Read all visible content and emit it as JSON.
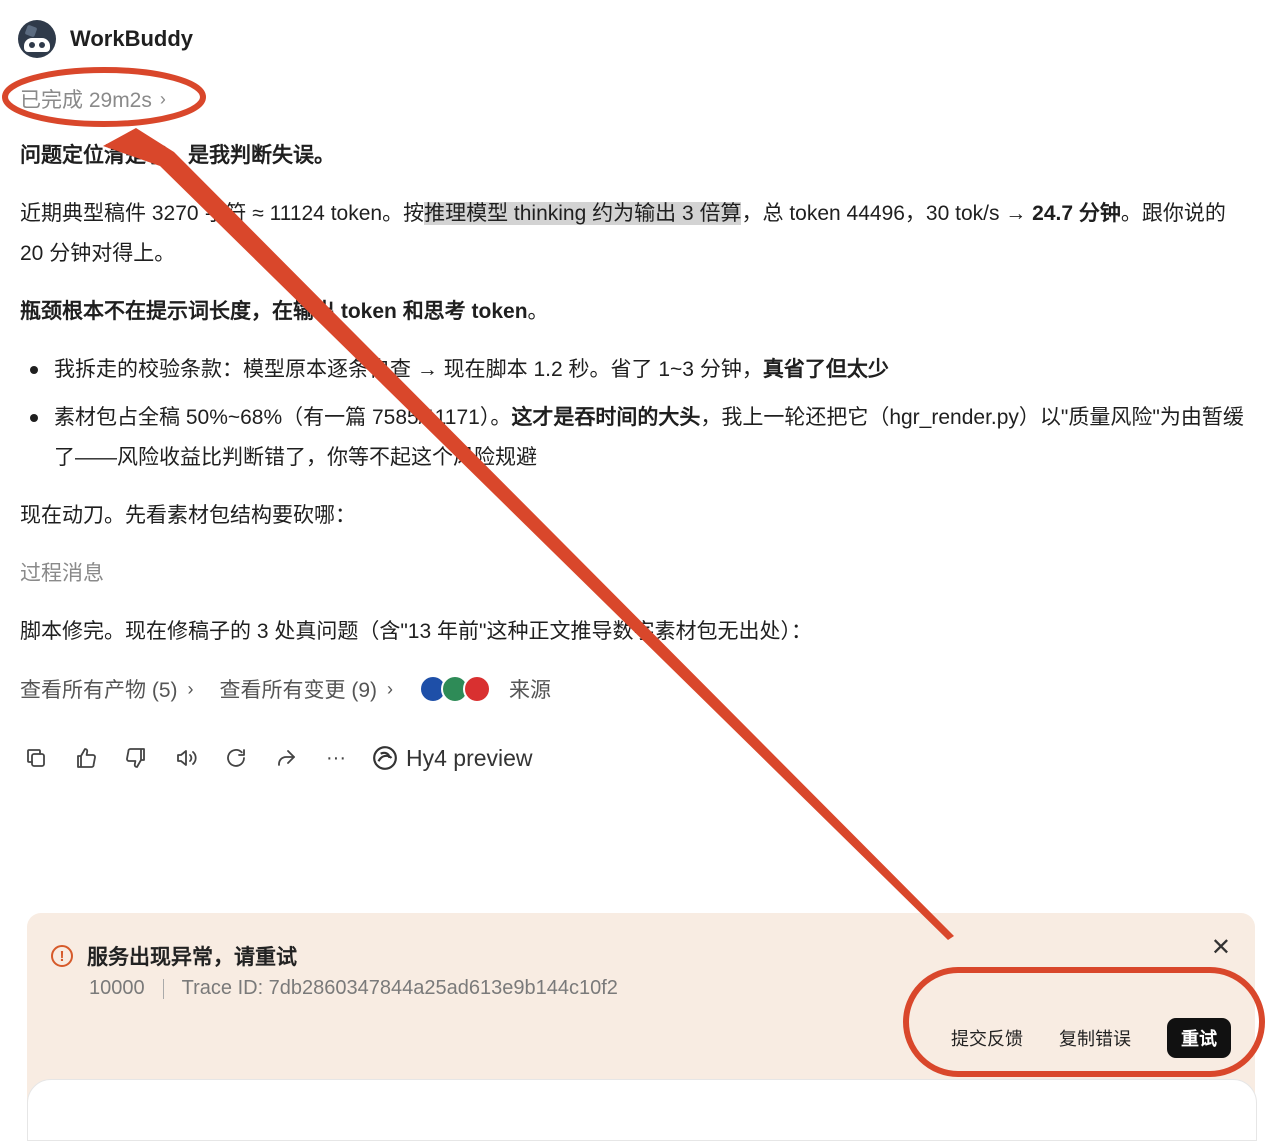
{
  "app": {
    "name": "WorkBuddy"
  },
  "status": {
    "text": "已完成 29m2s"
  },
  "message": {
    "p1": "问题定位清楚了，是我判断失误。",
    "p2_a": "近期典型稿件 3270 字符 ≈ 11124 token。按",
    "p2_hl": "推理模型 thinking 约为输出 3 倍算",
    "p2_b": "，总 token 44496，30 tok/s → ",
    "p2_bold": "24.7 分钟",
    "p2_c": "。跟你说的 20 分钟对得上。",
    "p3_bold_a": "瓶颈根本不在提示词长度，在输出",
    "p3_token1": " token ",
    "p3_bold_b": "和思考",
    "p3_token2": " token",
    "p3_end": "。",
    "b1_a": "我拆走的校验条款：模型原本逐条自查 → 现在脚本 1.2 秒。省了 1~3 分钟，",
    "b1_bold": "真省了但太少",
    "b2_a": "素材包占全稿 50%~68%（有一篇 7585/11171）。",
    "b2_bold": "这才是吞时间的大头",
    "b2_b": "，我上一轮还把它（hgr_render.py）以\"质量风险\"为由暂缓了——风险收益比判断错了，你等不起这个风险规避",
    "p4": "现在动刀。先看素材包结构要砍哪：",
    "p5": "过程消息",
    "p6": "脚本修完。现在修稿子的 3 处真问题（含\"13 年前\"这种正文推导数字素材包无出处）："
  },
  "links": {
    "artifacts": "查看所有产物 (5)",
    "changes": "查看所有变更 (9)",
    "sources": "来源"
  },
  "toolbar": {
    "model": "Hy4 preview",
    "more": "···"
  },
  "error": {
    "title": "服务出现异常，请重试",
    "code": "10000",
    "trace": "Trace ID: 7db2860347844a25ad613e9b144c10f2",
    "feedback": "提交反馈",
    "copy": "复制错误",
    "retry": "重试"
  },
  "colors": {
    "annotation": "#d9472b",
    "error_bg": "#f8ece2",
    "error_icon": "#d65a2a"
  }
}
